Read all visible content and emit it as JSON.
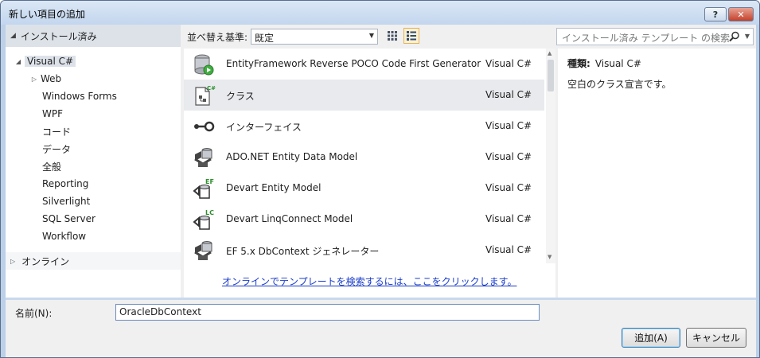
{
  "window": {
    "title": "新しい項目の追加",
    "help_label": "?",
    "close_label": "✕"
  },
  "tree": {
    "header": "インストール済み",
    "root": "Visual C#",
    "children": [
      "Web",
      "Windows Forms",
      "WPF",
      "コード",
      "データ",
      "全般",
      "Reporting",
      "Silverlight",
      "SQL Server",
      "Workflow"
    ],
    "online": "オンライン"
  },
  "toolbar": {
    "sort_label": "並べ替え基準:",
    "sort_value": "既定",
    "search_placeholder": "インストール済み テンプレート の検索"
  },
  "templates": [
    {
      "name": "EntityFramework Reverse POCO Code First Generator",
      "lang": "Visual C#",
      "icon": "database-icon"
    },
    {
      "name": "クラス",
      "lang": "Visual C#",
      "icon": "class-file-icon"
    },
    {
      "name": "インターフェイス",
      "lang": "Visual C#",
      "icon": "interface-icon"
    },
    {
      "name": "ADO.NET Entity Data Model",
      "lang": "Visual C#",
      "icon": "entity-model-icon"
    },
    {
      "name": "Devart Entity Model",
      "lang": "Visual C#",
      "icon": "devart-ef-icon"
    },
    {
      "name": "Devart LinqConnect Model",
      "lang": "Visual C#",
      "icon": "devart-lc-icon"
    },
    {
      "name": "EF 5.x DbContext ジェネレーター",
      "lang": "Visual C#",
      "icon": "dbcontext-icon"
    }
  ],
  "online_link": "オンラインでテンプレートを検索するには、ここをクリックします。",
  "details": {
    "type_label": "種類:",
    "type_value": "Visual C#",
    "description": "空白のクラス宣言です。"
  },
  "name_field": {
    "label": "名前(N):",
    "value": "OracleDbContext"
  },
  "buttons": {
    "add": "追加(A)",
    "cancel": "キャンセル"
  }
}
